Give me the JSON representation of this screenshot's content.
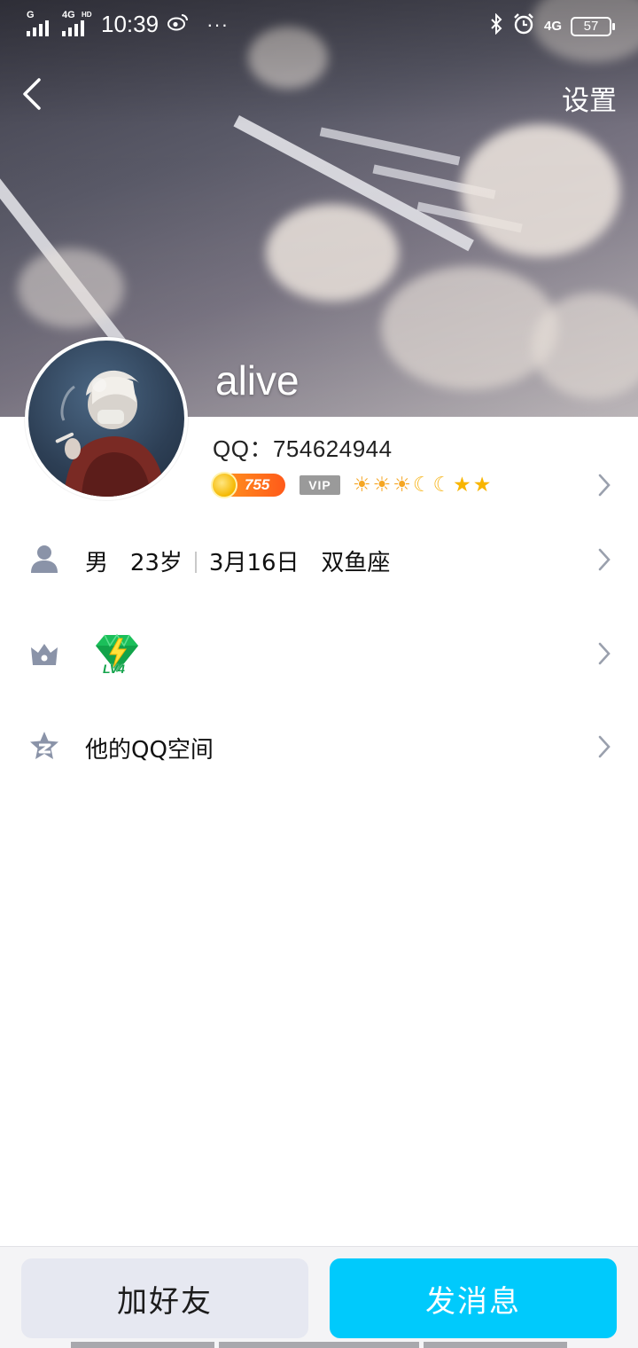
{
  "status_bar": {
    "signal1_label": "G",
    "signal2_label": "4G",
    "signal2_sup": "HD",
    "time": "10:39",
    "more": "···",
    "network": "4G",
    "battery": "57"
  },
  "nav": {
    "settings": "设置"
  },
  "profile": {
    "nickname": "alive",
    "qq_label": "QQ：",
    "qq_number": "754624944",
    "coin_count": "755",
    "vip": "VIP"
  },
  "level_icons": [
    "sun-icon",
    "sun-icon",
    "sun-icon",
    "moon-icon",
    "moon-icon",
    "star-icon",
    "star-icon"
  ],
  "info": {
    "gender": "男",
    "age": "23岁",
    "birthday": "3月16日",
    "zodiac": "双鱼座"
  },
  "badge_row": {
    "badge_text": "LV4"
  },
  "qzone": {
    "label": "他的QQ空间"
  },
  "actions": {
    "add_friend": "加好友",
    "send_message": "发消息"
  },
  "colors": {
    "primary_button": "#00cafc",
    "secondary_button": "#e6e8f1",
    "icon_gray": "#8a93a8"
  }
}
